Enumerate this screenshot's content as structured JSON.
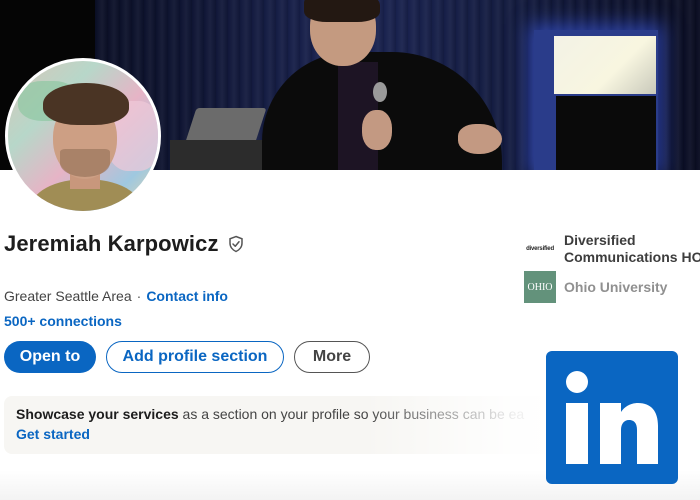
{
  "profile": {
    "name": "Jeremiah Karpowicz",
    "location": "Greater Seattle Area",
    "separator": "·",
    "contact_info": "Contact info",
    "connections": "500+ connections"
  },
  "actions": {
    "open_to": "Open to",
    "add_section": "Add profile section",
    "more": "More"
  },
  "showcase": {
    "bold": "Showcase your services",
    "rest": " as a section on your profile so your business can be ea",
    "cta": "Get started"
  },
  "companies": [
    {
      "logo_text": "diversified",
      "name_line1": "Diversified",
      "name_line2": "Communications HO"
    },
    {
      "logo_text": "OHIO",
      "name_line1": "Ohio University"
    }
  ],
  "icons": {
    "verified": "verified-shield-icon",
    "brand": "linkedin-icon"
  },
  "colors": {
    "brand_blue": "#0a66c2",
    "text_dark": "#1d1d1d",
    "text_muted": "#444444"
  }
}
